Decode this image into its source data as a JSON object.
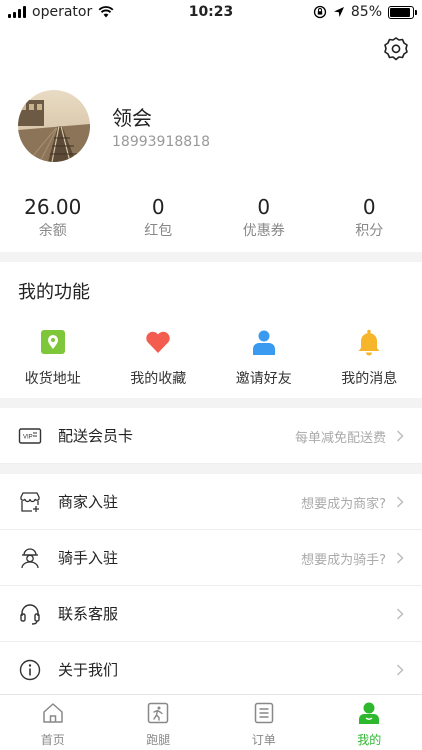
{
  "status": {
    "carrier": "operator",
    "time": "10:23",
    "battery": "85%",
    "battery_level": 0.85
  },
  "profile": {
    "name": "领会",
    "phone": "18993918818"
  },
  "stats": [
    {
      "value": "26.00",
      "label": "余额"
    },
    {
      "value": "0",
      "label": "红包"
    },
    {
      "value": "0",
      "label": "优惠券"
    },
    {
      "value": "0",
      "label": "积分"
    }
  ],
  "functions": {
    "title": "我的功能",
    "items": [
      {
        "label": "收货地址",
        "icon": "location-icon",
        "color": "#7ec73a"
      },
      {
        "label": "我的收藏",
        "icon": "heart-icon",
        "color": "#f25d4f"
      },
      {
        "label": "邀请好友",
        "icon": "person-icon",
        "color": "#3a9af0"
      },
      {
        "label": "我的消息",
        "icon": "bell-icon",
        "color": "#f7b52c"
      }
    ]
  },
  "member": {
    "label": "配送会员卡",
    "hint": "每单减免配送费"
  },
  "menu": [
    {
      "label": "商家入驻",
      "hint": "想要成为商家?",
      "icon": "store-icon"
    },
    {
      "label": "骑手入驻",
      "hint": "想要成为骑手?",
      "icon": "rider-icon"
    },
    {
      "label": "联系客服",
      "hint": "",
      "icon": "headset-icon"
    },
    {
      "label": "关于我们",
      "hint": "",
      "icon": "info-icon"
    }
  ],
  "tabs": [
    {
      "label": "首页",
      "icon": "home-icon"
    },
    {
      "label": "跑腿",
      "icon": "errand-icon"
    },
    {
      "label": "订单",
      "icon": "order-icon"
    },
    {
      "label": "我的",
      "icon": "mine-icon",
      "active": true
    }
  ],
  "colors": {
    "accent": "#2eb82e",
    "muted": "#aaaaaa",
    "separator": "#f3f3f3"
  }
}
